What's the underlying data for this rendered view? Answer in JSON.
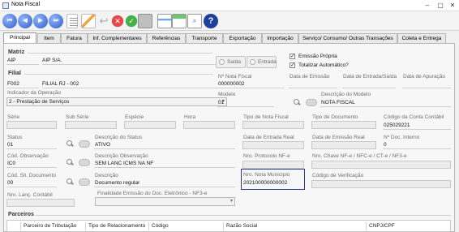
{
  "window": {
    "title": "Nota Fiscal"
  },
  "tabs": [
    "Principal",
    "Item",
    "Fatura",
    "Inf. Complementares",
    "Referências",
    "Transporte",
    "Exportação",
    "Importação",
    "Serviço/ Consumo/ Outras Transações",
    "Coleta e Entrega"
  ],
  "matriz": {
    "section": "Matriz",
    "code": "AIP",
    "name": "AIP S/A."
  },
  "filial": {
    "section": "Filial",
    "code": "F002",
    "name": "FILIAL RJ - 002"
  },
  "radio": {
    "saida": "Saída",
    "entrada": "Entrada"
  },
  "checks": {
    "emissao_propria": "Emissão Própria",
    "totalizar": "Totalizar Automático?"
  },
  "indicador": {
    "label": "Indicador da Operação",
    "value": "2 - Prestação de Serviços"
  },
  "nro_nota": {
    "label": "Nº Nota Fiscal",
    "value": "000000002"
  },
  "data_emissao": {
    "label": "Data de Emissão"
  },
  "data_entrada_saida": {
    "label": "Data de Entrada/Saída"
  },
  "data_apuracao": {
    "label": "Data de Apuração"
  },
  "modelo": {
    "label": "Modelo",
    "value": "01"
  },
  "desc_modelo": {
    "label": "Descrição do Modelo",
    "value": "NOTA FISCAL"
  },
  "serie": {
    "label": "Série"
  },
  "subserie": {
    "label": "Sub Série"
  },
  "especie": {
    "label": "Espécie"
  },
  "hora": {
    "label": "Hora"
  },
  "tipo_nota": {
    "label": "Tipo de Nota Fiscal"
  },
  "tipo_documento": {
    "label": "Tipo de Documento"
  },
  "conta_contabil": {
    "label": "Código da Conta Contábil",
    "value": "025029221"
  },
  "status": {
    "label": "Status",
    "value": "01"
  },
  "desc_status": {
    "label": "Descrição do Status",
    "value": "ATIVO"
  },
  "data_entrada_real": {
    "label": "Data de Entrada Real"
  },
  "data_emissao_real": {
    "label": "Data de Emissão Real"
  },
  "doc_interno": {
    "label": "Nº Doc. Interno",
    "value": "0"
  },
  "cod_obs": {
    "label": "Cód. Observação",
    "value": "IC0"
  },
  "desc_obs": {
    "label": "Descrição Observação",
    "value": "SEM LANC ICMS NA NF"
  },
  "protocolo": {
    "label": "Nro. Protocolo NF-e"
  },
  "chave": {
    "label": "Nro. Chave NF-e / NFC-e / CT-e / NF3-e"
  },
  "cod_sit": {
    "label": "Cód. Sit. Documento",
    "value": "00"
  },
  "descricao": {
    "label": "Descrição",
    "value": "Documento regular"
  },
  "nota_municipio": {
    "label": "Nro. Nota Município",
    "value": "202100000000002"
  },
  "cod_verificacao": {
    "label": "Código de Verificação"
  },
  "lanc_contabil": {
    "label": "Nro. Lanç. Contábil"
  },
  "finalidade": {
    "label": "Finalidade Emissão do Doc. Eletrônico - NF3-e"
  },
  "parceiros": {
    "section": "Parceiros",
    "columns": [
      "Parceiro de Tributação",
      "Tipo de Relacionamento",
      "Código",
      "Razão Social",
      "CNPJ/CPF"
    ]
  }
}
